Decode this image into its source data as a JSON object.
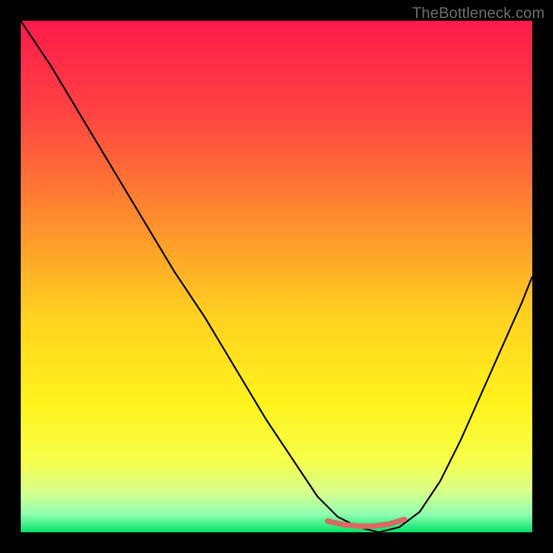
{
  "watermark": "TheBottleneck.com",
  "chart_data": {
    "type": "line",
    "title": "",
    "xlabel": "",
    "ylabel": "",
    "xlim": [
      0,
      100
    ],
    "ylim": [
      0,
      100
    ],
    "series": [
      {
        "name": "bottleneck-curve",
        "x": [
          0,
          6,
          12,
          18,
          24,
          30,
          36,
          42,
          48,
          54,
          58,
          62,
          66,
          70,
          74,
          78,
          82,
          86,
          90,
          94,
          98,
          100
        ],
        "values": [
          100,
          91,
          81,
          71,
          61,
          51,
          42,
          32,
          22,
          13,
          7,
          3,
          1,
          0,
          1,
          4,
          10,
          18,
          27,
          36,
          45,
          50
        ]
      },
      {
        "name": "optimal-range-marker",
        "x": [
          60,
          63,
          66,
          69,
          72,
          75
        ],
        "values": [
          2.2,
          1.5,
          1.2,
          1.2,
          1.6,
          2.5
        ]
      }
    ],
    "gradient_stops": [
      {
        "pos": 0.0,
        "color": "#ff1a4b"
      },
      {
        "pos": 0.18,
        "color": "#ff4342"
      },
      {
        "pos": 0.38,
        "color": "#ff8a2f"
      },
      {
        "pos": 0.58,
        "color": "#ffd21f"
      },
      {
        "pos": 0.75,
        "color": "#fff31c"
      },
      {
        "pos": 0.86,
        "color": "#f6ff4a"
      },
      {
        "pos": 0.92,
        "color": "#d9ff8a"
      },
      {
        "pos": 0.965,
        "color": "#8fffb0"
      },
      {
        "pos": 1.0,
        "color": "#00e36a"
      }
    ],
    "marker_color": "#d86a63"
  }
}
